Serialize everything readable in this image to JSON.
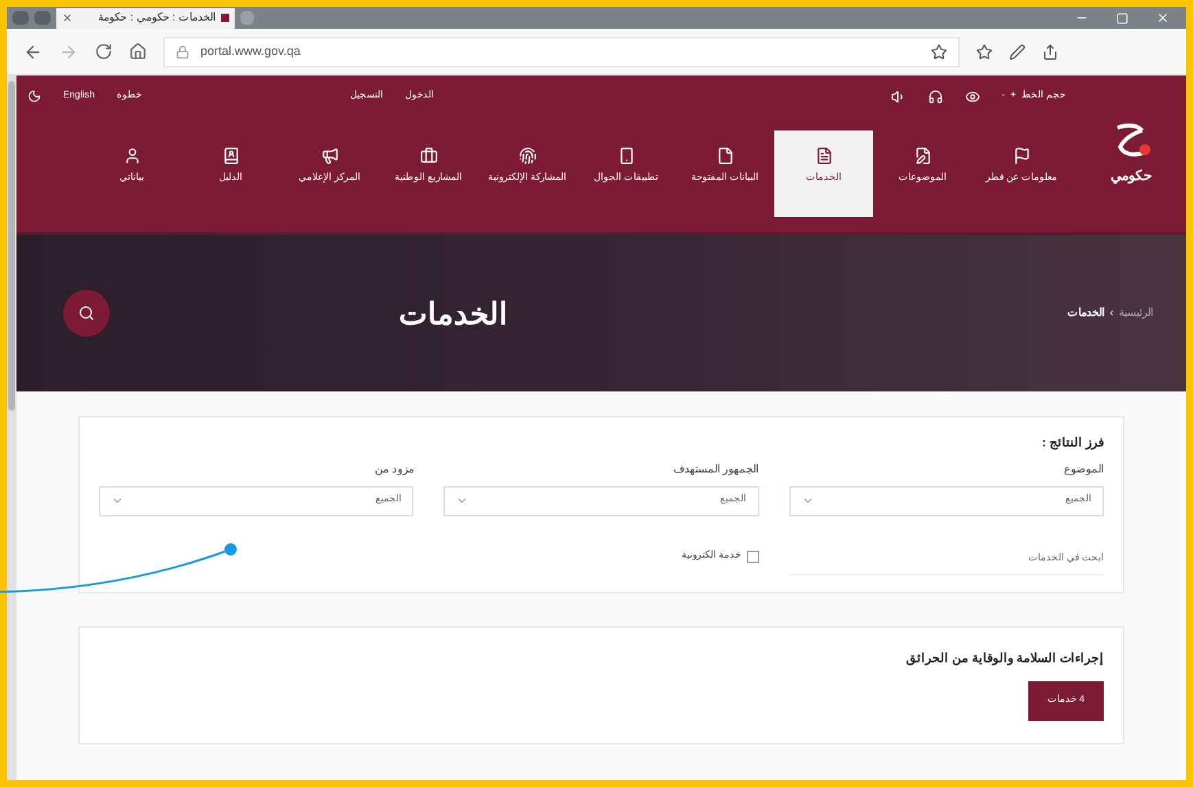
{
  "browser": {
    "tab_title": "الخدمات : حكومي : حكومة",
    "url": "portal.www.gov.qa"
  },
  "top_bar": {
    "left_links": [
      "خطوة",
      "English"
    ],
    "middle_links": [
      "الدخول",
      "التسجيل"
    ],
    "font_size": {
      "label": "حجم الخط",
      "increase": "+",
      "decrease": "-"
    }
  },
  "logo": {
    "text": "حكومي"
  },
  "nav": [
    {
      "label": "معلومات عن قطر",
      "selected": false
    },
    {
      "label": "الموضوعات",
      "selected": false
    },
    {
      "label": "الخدمات",
      "selected": true
    },
    {
      "label": "البيانات المفتوحة",
      "selected": false
    },
    {
      "label": "تطبيقات الجوال",
      "selected": false
    },
    {
      "label": "المشاركة الإلكترونية",
      "selected": false
    },
    {
      "label": "المشاريع الوطنية",
      "selected": false
    },
    {
      "label": "المركز الإعلامي",
      "selected": false
    },
    {
      "label": "الدليل",
      "selected": false
    },
    {
      "label": "بياناتي",
      "selected": false
    }
  ],
  "hero": {
    "breadcrumb": [
      "الرئيسية",
      "›",
      "الخدمات"
    ],
    "title": "الخدمات"
  },
  "filters": {
    "title": "فرز النتائج :",
    "selects": [
      {
        "label": "الموضوع",
        "value": "الجميع"
      },
      {
        "label": "الجمهور المستهدف",
        "value": "الجميع"
      },
      {
        "label": "مزود من",
        "value": "الجميع"
      }
    ],
    "search": {
      "placeholder": "ابحث في الخدمات"
    },
    "checkbox": {
      "label": "خدمة الكترونية",
      "checked": false
    }
  },
  "results": [
    {
      "title": "إجراءات السلامة والوقاية من الحرائق",
      "button": "4 خدمات"
    }
  ]
}
